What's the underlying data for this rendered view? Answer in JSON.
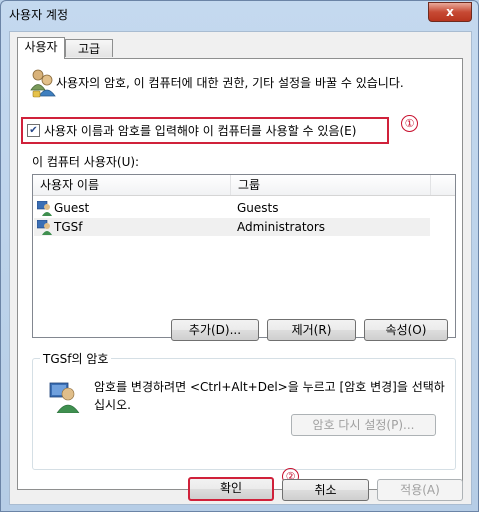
{
  "window": {
    "title": "사용자 계정",
    "close_glyph": "x"
  },
  "tabs": [
    {
      "label": "사용자"
    },
    {
      "label": "고급"
    }
  ],
  "panel": {
    "description": "사용자의 암호, 이 컴퓨터에 대한  권한, 기타 설정을 바꿀 수 있습니다.",
    "checkbox_label": "사용자 이름과 암호를 입력해야 이 컴퓨터를 사용할 수 있음(E)",
    "checkbox_checked": true,
    "annotation_1": "①",
    "list_caption": "이 컴퓨터 사용자(U):",
    "columns": [
      "사용자 이름",
      "그룹"
    ],
    "users": [
      {
        "name": "Guest",
        "group": "Guests"
      },
      {
        "name": "TGSf",
        "group": "Administrators"
      }
    ],
    "buttons": {
      "add": "추가(D)...",
      "remove": "제거(R)",
      "properties": "속성(O)"
    },
    "password_group": {
      "title": "TGSf의 암호",
      "text": "암호를 변경하려면 <Ctrl+Alt+Del>을 누르고 [암호 변경]을 선택하십시오.",
      "reset_button": "암호 다시 설정(P)..."
    }
  },
  "footer": {
    "ok": "확인",
    "cancel": "취소",
    "apply": "적용(A)",
    "annotation_2": "②"
  },
  "colors": {
    "highlight_box": "#d0213a",
    "annotation": "#c8102e"
  },
  "icons": [
    "users-icon",
    "user-icon",
    "admin-user-icon",
    "password-user-icon"
  ]
}
